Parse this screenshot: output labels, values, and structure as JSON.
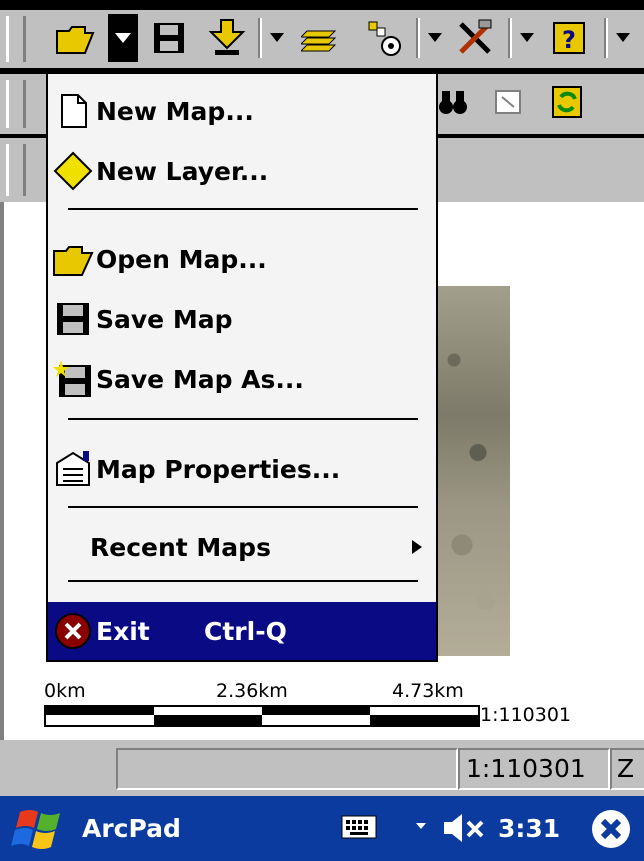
{
  "menu": {
    "items": [
      {
        "label": "New Map...",
        "icon": "document-icon"
      },
      {
        "label": "New Layer...",
        "icon": "diamond-icon"
      },
      {
        "label": "Open Map...",
        "icon": "open-folder-icon"
      },
      {
        "label": "Save Map",
        "icon": "floppy-icon"
      },
      {
        "label": "Save Map As...",
        "icon": "floppy-star-icon"
      },
      {
        "label": "Map Properties...",
        "icon": "properties-icon"
      },
      {
        "label": "Recent Maps",
        "icon": "submenu-arrow-icon"
      }
    ],
    "exit": {
      "label": "Exit",
      "shortcut": "Ctrl-Q"
    }
  },
  "scale": {
    "labels": [
      "0km",
      "2.36km",
      "4.73km"
    ],
    "ratio": "1:110301"
  },
  "status": {
    "scale": "1:110301",
    "extra": "Z"
  },
  "taskbar": {
    "app": "ArcPad",
    "time": "3:31"
  },
  "colors": {
    "menu_highlight": "#0a0a84",
    "taskbar": "#0b3b9e",
    "toolbar": "#c0c0c0"
  }
}
